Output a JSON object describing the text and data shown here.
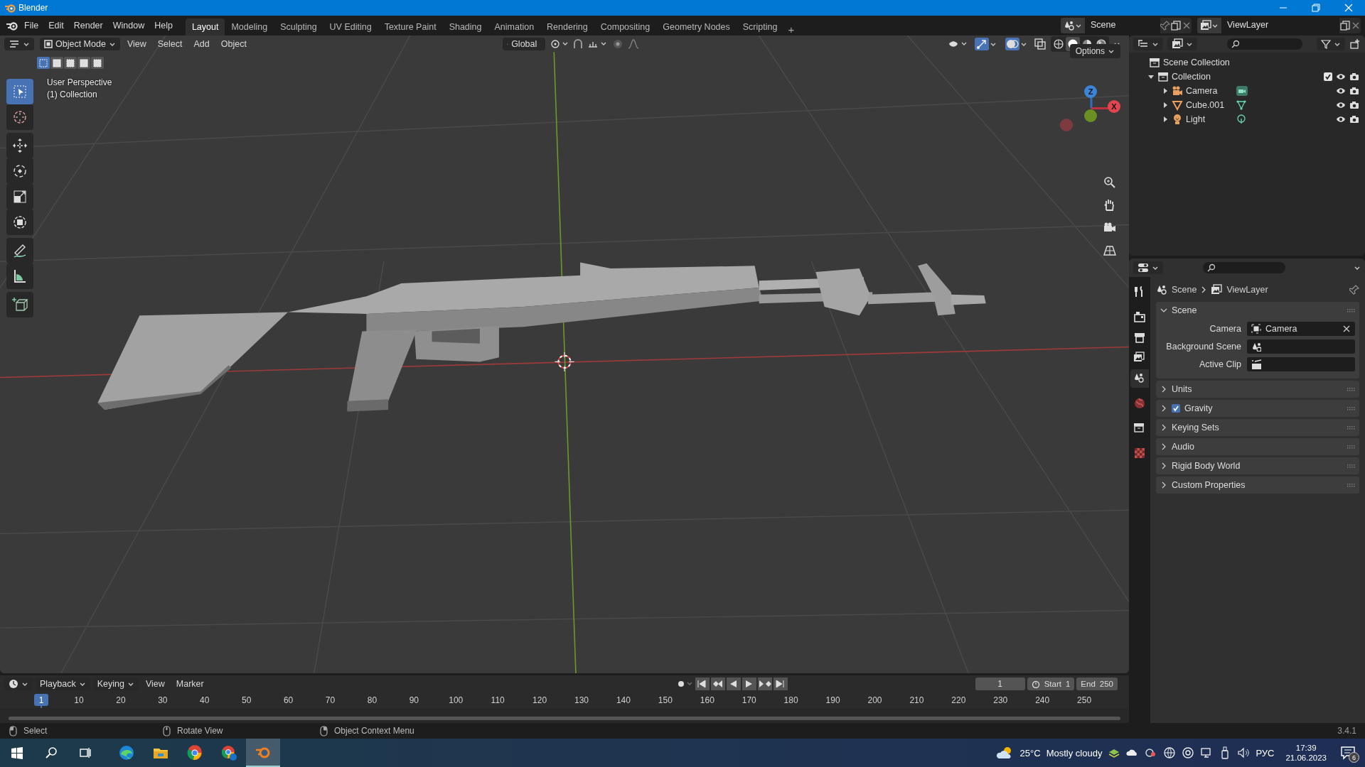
{
  "window": {
    "title": "Blender"
  },
  "top_bar": {
    "menus": [
      "File",
      "Edit",
      "Render",
      "Window",
      "Help"
    ],
    "workspaces": [
      {
        "label": "Layout",
        "selected": true
      },
      {
        "label": "Modeling",
        "selected": false
      },
      {
        "label": "Sculpting",
        "selected": false
      },
      {
        "label": "UV Editing",
        "selected": false
      },
      {
        "label": "Texture Paint",
        "selected": false
      },
      {
        "label": "Shading",
        "selected": false
      },
      {
        "label": "Animation",
        "selected": false
      },
      {
        "label": "Rendering",
        "selected": false
      },
      {
        "label": "Compositing",
        "selected": false
      },
      {
        "label": "Geometry Nodes",
        "selected": false
      },
      {
        "label": "Scripting",
        "selected": false
      }
    ],
    "add_workspace": "+",
    "scene": "Scene",
    "view_layer": "ViewLayer"
  },
  "viewport": {
    "header": {
      "mode": "Object Mode",
      "menus": [
        "View",
        "Select",
        "Add",
        "Object"
      ],
      "orientation": "Global",
      "gizmos_on": true,
      "overlays_on": true,
      "shading_modes": [
        {
          "kind": "wireframe",
          "selected": false
        },
        {
          "kind": "solid",
          "selected": true
        },
        {
          "kind": "material",
          "selected": false
        },
        {
          "kind": "rendered",
          "selected": false
        }
      ],
      "options": "Options"
    },
    "select_modes": [
      {
        "selected": true
      },
      {
        "selected": false
      },
      {
        "selected": false
      },
      {
        "selected": false
      },
      {
        "selected": false
      }
    ],
    "tools": [
      {
        "kind": "select",
        "selected": true
      },
      {
        "kind": "cursor",
        "selected": false
      },
      {
        "kind": "move",
        "selected": false
      },
      {
        "kind": "rotate",
        "selected": false
      },
      {
        "kind": "scale",
        "selected": false
      },
      {
        "kind": "transform",
        "selected": false
      },
      {
        "kind": "annotate",
        "selected": false
      },
      {
        "kind": "measure",
        "selected": false
      },
      {
        "kind": "add_cube",
        "selected": false
      }
    ],
    "info": [
      "User Perspective",
      "(1) Collection"
    ],
    "gizmo": {
      "z": "Z",
      "x": "X"
    }
  },
  "outliner": {
    "root": "Scene Collection",
    "items": [
      {
        "label": "Collection",
        "expanded": true,
        "checked": true,
        "children": [
          {
            "label": "Camera",
            "kind": "camera",
            "expanded": false
          },
          {
            "label": "Cube.001",
            "kind": "mesh",
            "expanded": false
          },
          {
            "label": "Light",
            "kind": "light",
            "expanded": false
          }
        ]
      }
    ]
  },
  "properties": {
    "tabs": [
      {
        "kind": "tool",
        "selected": false
      },
      {
        "kind": "render",
        "selected": false
      },
      {
        "kind": "output",
        "selected": false
      },
      {
        "kind": "view_layer",
        "selected": false
      },
      {
        "kind": "scene",
        "selected": true
      },
      {
        "kind": "world",
        "selected": false
      },
      {
        "kind": "collection",
        "selected": false
      },
      {
        "kind": "texture",
        "selected": false
      }
    ],
    "breadcrumb": [
      "Scene",
      "ViewLayer"
    ],
    "panels": [
      {
        "title": "Scene",
        "kind": "plain",
        "expanded": true,
        "fields": [
          {
            "label": "Camera",
            "value": "Camera",
            "kind": "camera"
          },
          {
            "label": "Background Scene",
            "kind": "scene"
          },
          {
            "label": "Active Clip",
            "kind": "clip"
          }
        ]
      },
      {
        "title": "Units",
        "kind": "plain",
        "expanded": false
      },
      {
        "title": "Gravity",
        "kind": "checkbox",
        "checked": true,
        "expanded": false
      },
      {
        "title": "Keying Sets",
        "kind": "plain",
        "expanded": false
      },
      {
        "title": "Audio",
        "kind": "plain",
        "expanded": false
      },
      {
        "title": "Rigid Body World",
        "kind": "plain",
        "expanded": false
      },
      {
        "title": "Custom Properties",
        "kind": "plain",
        "expanded": false
      }
    ]
  },
  "timeline": {
    "menus": [
      "Playback",
      "Keying",
      "View",
      "Marker"
    ],
    "current_frame": "1",
    "start_label": "Start",
    "start": "1",
    "end_label": "End",
    "end": "250",
    "playhead": "1",
    "ticks": [
      "10",
      "20",
      "30",
      "40",
      "50",
      "60",
      "70",
      "80",
      "90",
      "100",
      "110",
      "120",
      "130",
      "140",
      "150",
      "160",
      "170",
      "180",
      "190",
      "200",
      "210",
      "220",
      "230",
      "240",
      "250"
    ]
  },
  "status_bar": {
    "hints": [
      "Select",
      "Rotate View",
      "Object Context Menu"
    ],
    "version": "3.4.1"
  },
  "taskbar": {
    "apps": [
      {
        "kind": "browser_wave",
        "selected": false
      },
      {
        "kind": "folder",
        "selected": false
      },
      {
        "kind": "browser_round",
        "selected": false
      },
      {
        "kind": "browser_profile",
        "selected": false
      },
      {
        "kind": "modeler",
        "selected": true
      }
    ],
    "weather": "25°C",
    "condition": "Mostly cloudy",
    "language": "РУС",
    "time": "17:39",
    "date": "21.06.2023",
    "notifications": "6"
  }
}
